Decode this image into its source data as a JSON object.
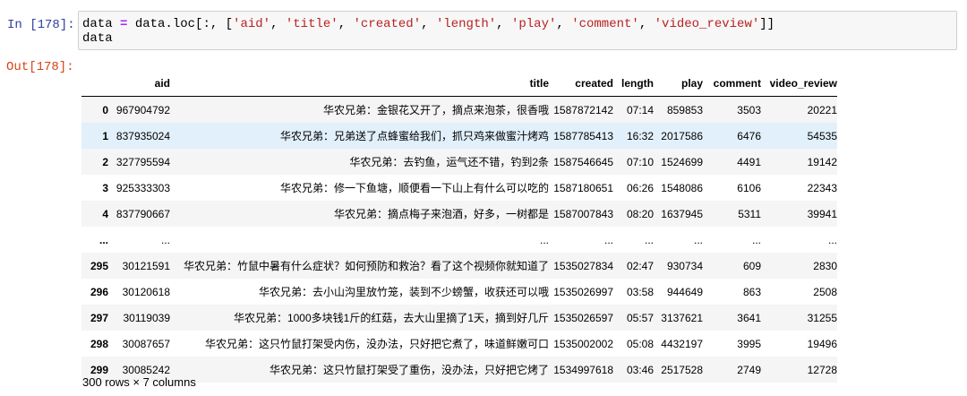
{
  "input_cell": {
    "prompt": "In [178]:",
    "code": {
      "l1_var": "data",
      "l1_eq": "=",
      "l1_call": "data.loc[:, [",
      "l1_cols": [
        "'aid'",
        "'title'",
        "'created'",
        "'length'",
        "'play'",
        "'comment'",
        "'video_review'"
      ],
      "l1_end": "]]",
      "l2": "data"
    }
  },
  "output_cell": {
    "prompt": "Out[178]:"
  },
  "dataframe": {
    "columns": [
      "aid",
      "title",
      "created",
      "length",
      "play",
      "comment",
      "video_review"
    ],
    "rows": [
      {
        "index": "0",
        "aid": "967904792",
        "title": "华农兄弟：金银花又开了，摘点来泡茶，很香哦",
        "created": "1587872142",
        "length": "07:14",
        "play": "859853",
        "comment": "3503",
        "video_review": "20221"
      },
      {
        "index": "1",
        "aid": "837935024",
        "title": "华农兄弟：兄弟送了点蜂蜜给我们，抓只鸡来做蜜汁烤鸡",
        "created": "1587785413",
        "length": "16:32",
        "play": "2017586",
        "comment": "6476",
        "video_review": "54535"
      },
      {
        "index": "2",
        "aid": "327795594",
        "title": "华农兄弟：去钓鱼，运气还不错，钓到2条",
        "created": "1587546645",
        "length": "07:10",
        "play": "1524699",
        "comment": "4491",
        "video_review": "19142"
      },
      {
        "index": "3",
        "aid": "925333303",
        "title": "华农兄弟：修一下鱼塘，顺便看一下山上有什么可以吃的",
        "created": "1587180651",
        "length": "06:26",
        "play": "1548086",
        "comment": "6106",
        "video_review": "22343"
      },
      {
        "index": "4",
        "aid": "837790667",
        "title": "华农兄弟：摘点梅子来泡酒，好多，一树都是",
        "created": "1587007843",
        "length": "08:20",
        "play": "1637945",
        "comment": "5311",
        "video_review": "39941"
      },
      {
        "index": "...",
        "aid": "...",
        "title": "...",
        "created": "...",
        "length": "...",
        "play": "...",
        "comment": "...",
        "video_review": "..."
      },
      {
        "index": "295",
        "aid": "30121591",
        "title": "华农兄弟：竹鼠中暑有什么症状？如何预防和救治？看了这个视频你就知道了",
        "created": "1535027834",
        "length": "02:47",
        "play": "930734",
        "comment": "609",
        "video_review": "2830"
      },
      {
        "index": "296",
        "aid": "30120618",
        "title": "华农兄弟：去小山沟里放竹笼，装到不少螃蟹，收获还可以哦",
        "created": "1535026997",
        "length": "03:58",
        "play": "944649",
        "comment": "863",
        "video_review": "2508"
      },
      {
        "index": "297",
        "aid": "30119039",
        "title": "华农兄弟：1000多块钱1斤的红菇，去大山里摘了1天，摘到好几斤",
        "created": "1535026597",
        "length": "05:57",
        "play": "3137621",
        "comment": "3641",
        "video_review": "31255"
      },
      {
        "index": "298",
        "aid": "30087657",
        "title": "华农兄弟：这只竹鼠打架受内伤，没办法，只好把它煮了，味道鲜嫩可口",
        "created": "1535002002",
        "length": "05:08",
        "play": "4432197",
        "comment": "3995",
        "video_review": "19496"
      },
      {
        "index": "299",
        "aid": "30085242",
        "title": "华农兄弟：这只竹鼠打架受了重伤，没办法，只好把它烤了",
        "created": "1534997618",
        "length": "03:46",
        "play": "2517528",
        "comment": "2749",
        "video_review": "12728"
      }
    ],
    "hovered_row_index": 1,
    "footer": "300 rows × 7 columns"
  }
}
